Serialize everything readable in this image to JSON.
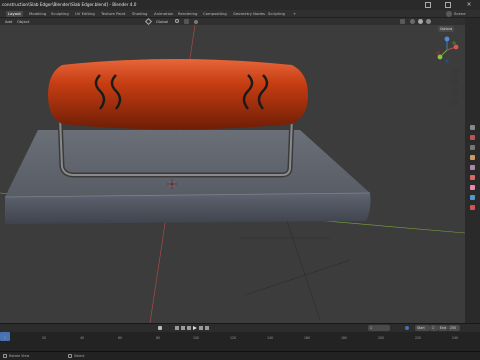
{
  "window": {
    "title": "construction\\Slab Edger\\Blender\\Slab Edger.blend] - Blender 4.0"
  },
  "workspaces": [
    {
      "label": "Layout",
      "active": true
    },
    {
      "label": "Modeling",
      "active": false
    },
    {
      "label": "Sculpting",
      "active": false
    },
    {
      "label": "UV Editing",
      "active": false
    },
    {
      "label": "Texture Paint",
      "active": false
    },
    {
      "label": "Shading",
      "active": false
    },
    {
      "label": "Animation",
      "active": false
    },
    {
      "label": "Rendering",
      "active": false
    },
    {
      "label": "Compositing",
      "active": false
    },
    {
      "label": "Geometry Nodes",
      "active": false
    },
    {
      "label": "Scripting",
      "active": false
    }
  ],
  "workspace_add": "+",
  "scene": {
    "label": "Scene"
  },
  "header": {
    "add_label": "Add",
    "object_label": "Object",
    "transform_label": "Global",
    "options_label": "Options"
  },
  "timeline": {
    "start_label": "Start",
    "start_value": "1",
    "end_label": "End",
    "end_value": "250",
    "current_frame": "1",
    "ticks": [
      "0",
      "20",
      "40",
      "60",
      "80",
      "100",
      "120",
      "140",
      "160",
      "180",
      "200",
      "220",
      "240"
    ]
  },
  "statusbar": {
    "left": "Rotate View",
    "mid": "Select"
  },
  "colors": {
    "accent": "#4772b3",
    "handle": "#c63d12",
    "slab": "#5c6068",
    "x_axis": "#b84c4c",
    "y_axis": "#7aa33b",
    "z_axis": "#4a77b5"
  },
  "icons": [
    "zoom-icon",
    "hand-icon",
    "camera-icon",
    "grid-icon",
    "play-icon",
    "tool-icon",
    "object-icon",
    "modifier-icon",
    "material-icon"
  ]
}
